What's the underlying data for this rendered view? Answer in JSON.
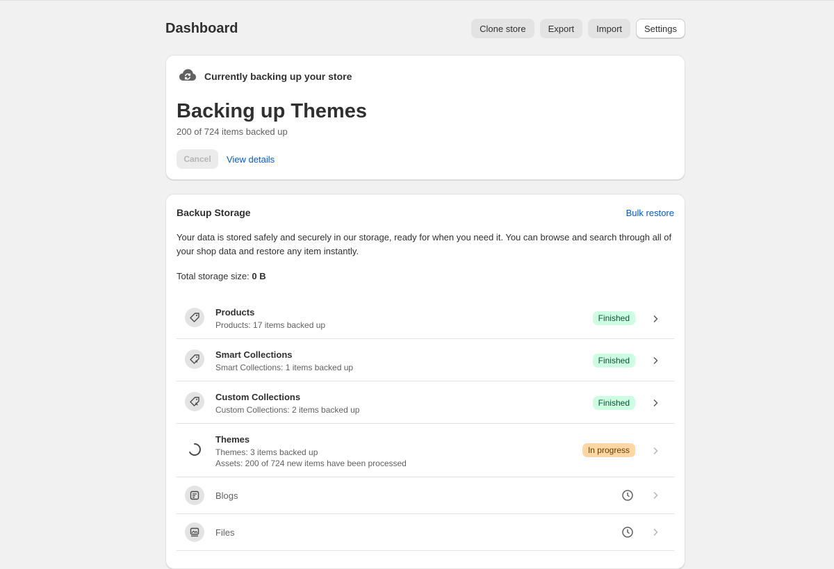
{
  "header": {
    "title": "Dashboard",
    "buttons": {
      "clone": "Clone store",
      "export": "Export",
      "import": "Import",
      "settings": "Settings"
    }
  },
  "backup_card": {
    "status_text": "Currently backing up your store",
    "title": "Backing up Themes",
    "progress_text": "200 of 724 items backed up",
    "progress": {
      "done": 200,
      "total": 724
    },
    "cancel_label": "Cancel",
    "view_details_label": "View details"
  },
  "storage": {
    "title": "Backup Storage",
    "bulk_restore_label": "Bulk restore",
    "description": "Your data is stored safely and securely in our storage, ready for when you need it. You can browse and search through all of your shop data and restore any item instantly.",
    "total_label": "Total storage size:",
    "total_value": "0 B",
    "items": [
      {
        "name": "Products",
        "sub": "Products: 17 items backed up",
        "status": "Finished",
        "icon": "tag-icon"
      },
      {
        "name": "Smart Collections",
        "sub": "Smart Collections: 1 items backed up",
        "status": "Finished",
        "icon": "smart-collection-icon"
      },
      {
        "name": "Custom Collections",
        "sub": "Custom Collections: 2 items backed up",
        "status": "Finished",
        "icon": "custom-collection-icon"
      },
      {
        "name": "Themes",
        "sub": "Themes: 3 items backed up",
        "sub2": "Assets: 200 of 724 new items have been processed",
        "status": "In progress",
        "icon": "spinner-icon"
      },
      {
        "name": "Blogs",
        "status": "pending",
        "icon": "blog-icon"
      },
      {
        "name": "Files",
        "status": "pending",
        "icon": "files-icon"
      }
    ]
  },
  "colors": {
    "link": "#005bd3",
    "finished_bg": "#cdfee1",
    "in_progress_bg": "#ffd6a4",
    "background": "#f1f1f1"
  }
}
